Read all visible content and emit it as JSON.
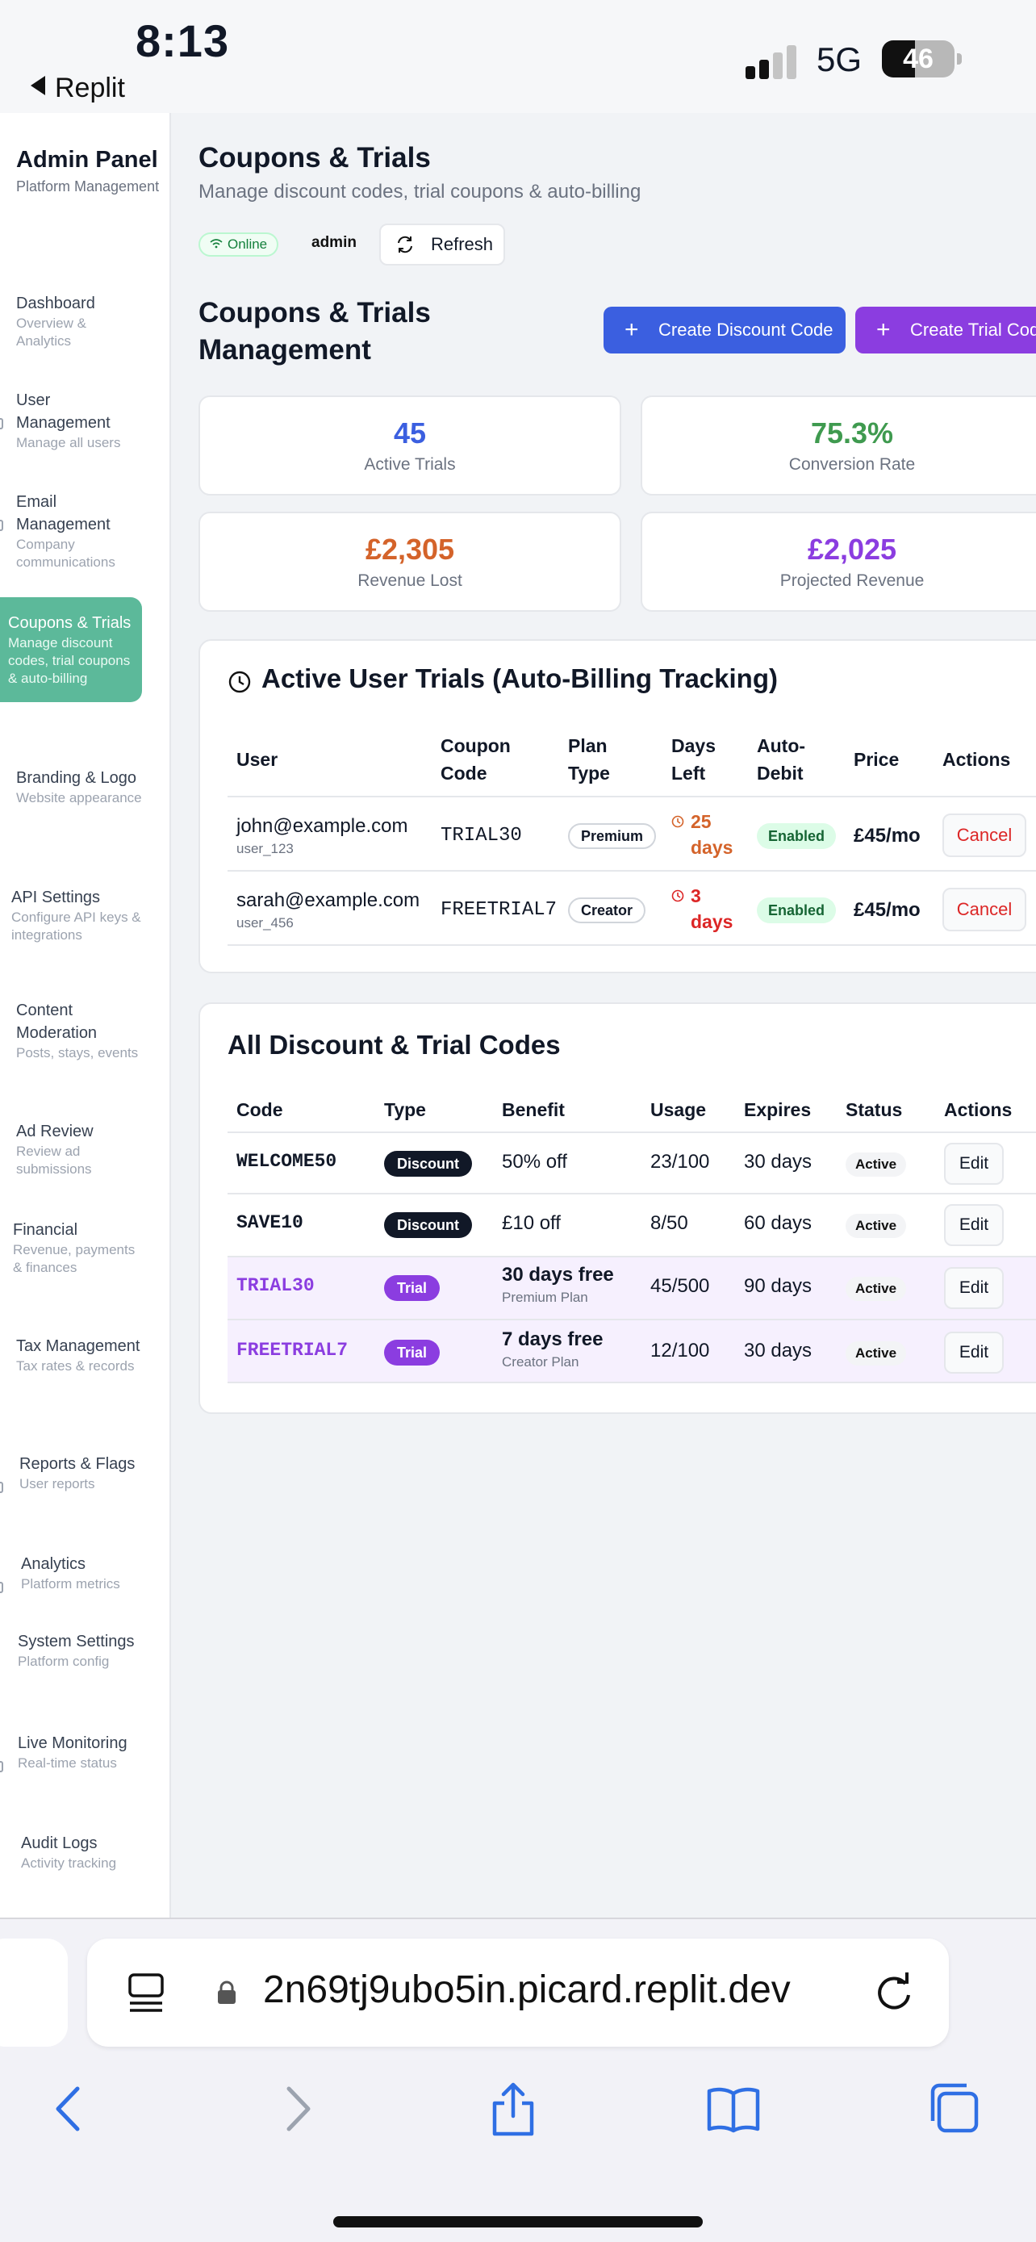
{
  "status_bar": {
    "time": "8:13",
    "back_label": "Replit",
    "network": "5G",
    "battery": "46",
    "battery_fraction": 0.46
  },
  "sidebar": {
    "title": "Admin Panel",
    "subtitle": "Platform Management",
    "items": [
      {
        "label": "Dashboard",
        "desc": "Overview & Analytics"
      },
      {
        "label": "User Management",
        "desc": "Manage all users"
      },
      {
        "label": "Email Management",
        "desc": "Company communications"
      },
      {
        "label": "Coupons & Trials",
        "desc": "Manage discount codes, trial coupons & auto-billing"
      },
      {
        "label": "Branding & Logo",
        "desc": "Website appearance"
      },
      {
        "label": "API Settings",
        "desc": "Configure API keys & integrations"
      },
      {
        "label": "Content Moderation",
        "desc": "Posts, stays, events"
      },
      {
        "label": "Ad Review",
        "desc": "Review ad submissions"
      },
      {
        "label": "Financial",
        "desc": "Revenue, payments & finances"
      },
      {
        "label": "Tax Management",
        "desc": "Tax rates & records"
      },
      {
        "label": "Reports & Flags",
        "desc": "User reports"
      },
      {
        "label": "Analytics",
        "desc": "Platform metrics"
      },
      {
        "label": "System Settings",
        "desc": "Platform config"
      },
      {
        "label": "Live Monitoring",
        "desc": "Real-time status"
      },
      {
        "label": "Audit Logs",
        "desc": "Activity tracking"
      }
    ]
  },
  "header": {
    "title": "Coupons & Trials",
    "subtitle": "Manage discount codes, trial coupons & auto-billing",
    "status": "Online",
    "user": "admin",
    "refresh": "Refresh"
  },
  "management": {
    "title": "Coupons & Trials Management",
    "create_discount": "Create Discount Code",
    "create_trial": "Create Trial Code"
  },
  "stats": [
    {
      "value": "45",
      "label": "Active Trials",
      "color": "#3b5fe0"
    },
    {
      "value": "75.3%",
      "label": "Conversion Rate",
      "color": "#3f9a4f"
    },
    {
      "value": "£2,305",
      "label": "Revenue Lost",
      "color": "#d4632a"
    },
    {
      "value": "£2,025",
      "label": "Projected Revenue",
      "color": "#8b3de0"
    }
  ],
  "trials": {
    "title": "Active User Trials (Auto-Billing Tracking)",
    "headers": {
      "user": "User",
      "coupon": "Coupon Code",
      "plan": "Plan Type",
      "days": "Days Left",
      "auto": "Auto-Debit",
      "price": "Price",
      "actions": "Actions"
    },
    "rows": [
      {
        "email": "john@example.com",
        "id": "user_123",
        "code": "TRIAL30",
        "plan": "Premium",
        "days_num": "25",
        "days_unit": "days",
        "auto": "Enabled",
        "price": "£45/mo",
        "action": "Cancel"
      },
      {
        "email": "sarah@example.com",
        "id": "user_456",
        "code": "FREETRIAL7",
        "plan": "Creator",
        "days_num": "3",
        "days_unit": "days",
        "auto": "Enabled",
        "price": "£45/mo",
        "action": "Cancel"
      }
    ]
  },
  "codes": {
    "title": "All Discount & Trial Codes",
    "headers": {
      "code": "Code",
      "type": "Type",
      "benefit": "Benefit",
      "usage": "Usage",
      "expires": "Expires",
      "status": "Status",
      "actions": "Actions"
    },
    "rows": [
      {
        "code": "WELCOME50",
        "type": "Discount",
        "benefit": "50% off",
        "benefit_sub": "",
        "usage": "23/100",
        "expires": "30 days",
        "status": "Active",
        "action": "Edit"
      },
      {
        "code": "SAVE10",
        "type": "Discount",
        "benefit": "£10 off",
        "benefit_sub": "",
        "usage": "8/50",
        "expires": "60 days",
        "status": "Active",
        "action": "Edit"
      },
      {
        "code": "TRIAL30",
        "type": "Trial",
        "benefit": "30 days free",
        "benefit_sub": "Premium Plan",
        "usage": "45/500",
        "expires": "90 days",
        "status": "Active",
        "action": "Edit"
      },
      {
        "code": "FREETRIAL7",
        "type": "Trial",
        "benefit": "7 days free",
        "benefit_sub": "Creator Plan",
        "usage": "12/100",
        "expires": "30 days",
        "status": "Active",
        "action": "Edit"
      }
    ]
  },
  "browser": {
    "url": "2n69tj9ubo5in.picard.replit.dev"
  },
  "icons": [
    "back-triangle-icon",
    "signal-icon",
    "battery-icon",
    "wifi-icon",
    "refresh-icon",
    "plus-icon",
    "clock-icon",
    "reader-icon",
    "lock-icon",
    "reload-icon",
    "back-icon",
    "forward-icon",
    "share-icon",
    "bookmarks-icon",
    "tabs-icon"
  ]
}
